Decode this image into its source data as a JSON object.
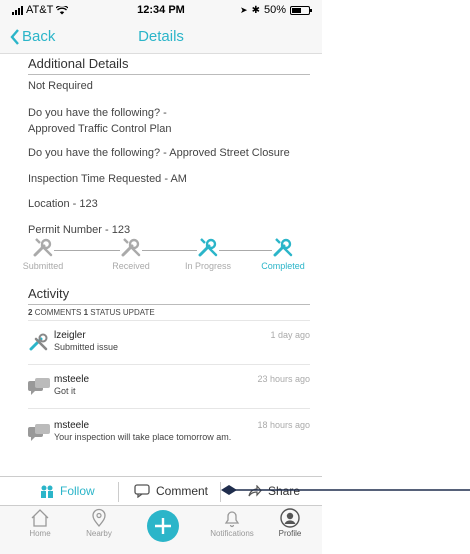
{
  "status_bar": {
    "carrier": "AT&T",
    "time": "12:34 PM",
    "battery": "50%"
  },
  "nav": {
    "back_label": "Back",
    "title": "Details"
  },
  "details": {
    "section_title": "Additional Details",
    "lines": [
      "Not Required",
      "Do you have the following? -",
      "Approved Traffic Control Plan",
      "Do you have the following? - Approved Street Closure",
      "Inspection Time Requested - AM",
      "Location - 123",
      "Permit Number - 123"
    ]
  },
  "steps": [
    "Submitted",
    "Received",
    "In Progress",
    "Completed"
  ],
  "activity": {
    "title": "Activity",
    "comments_count": "2",
    "comments_label": "COMMENTS",
    "status_count": "1",
    "status_label": "STATUS UPDATE",
    "items": [
      {
        "name": "lzeigler",
        "message": "Submitted issue",
        "time": "1 day ago",
        "icon": "wrench-screwdriver-icon"
      },
      {
        "name": "msteele",
        "message": "Got it",
        "time": "23 hours ago",
        "icon": "chat-bubbles-icon"
      },
      {
        "name": "msteele",
        "message": "Your inspection will take place tomorrow am.",
        "time": "18 hours ago",
        "icon": "chat-bubbles-icon"
      }
    ]
  },
  "actions": {
    "follow": "Follow",
    "comment": "Comment",
    "share": "Share"
  },
  "tabs": [
    {
      "label": "Home",
      "icon": "home-icon"
    },
    {
      "label": "Nearby",
      "icon": "location-pin-icon"
    },
    {
      "label": "",
      "icon": "plus-icon"
    },
    {
      "label": "Notifications",
      "icon": "bell-icon"
    },
    {
      "label": "Profile",
      "icon": "profile-icon"
    }
  ],
  "colors": {
    "accent": "#2bb5c9",
    "muted": "#aaaaaa",
    "annotation": "#1f2d4d"
  }
}
